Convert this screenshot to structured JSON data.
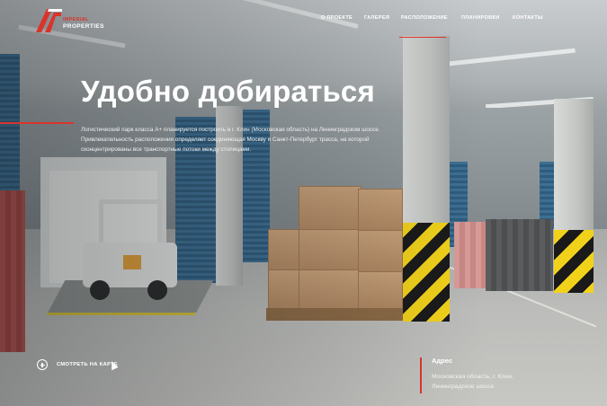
{
  "brand": {
    "logo_top": "IMPERIAL",
    "logo_text": "PROPERTIES",
    "accent_color": "#d9342b"
  },
  "nav": {
    "items": [
      {
        "label": "О проекте",
        "active": false
      },
      {
        "label": "Галерея",
        "active": false
      },
      {
        "label": "Расположение",
        "active": true
      },
      {
        "label": "Планировки",
        "active": false
      },
      {
        "label": "Контакты",
        "active": false
      }
    ]
  },
  "hero": {
    "title": "Удобно добираться",
    "description": "Логистический парк класса А+ планируется построить в г. Клин (Московская область) на Ленинградском шоссе. Привлекательность расположения определяет соединяющая Москву и Санкт-Петербург трасса, на которой сконцентрированы все транспортные потоки между столицами."
  },
  "map_link": {
    "icon": "plus-circle-icon",
    "label": "Смотреть на карте"
  },
  "address": {
    "title": "Адрес",
    "line1": "Московская область, г. Клин,",
    "line2": "Ленинградское шоссе"
  }
}
